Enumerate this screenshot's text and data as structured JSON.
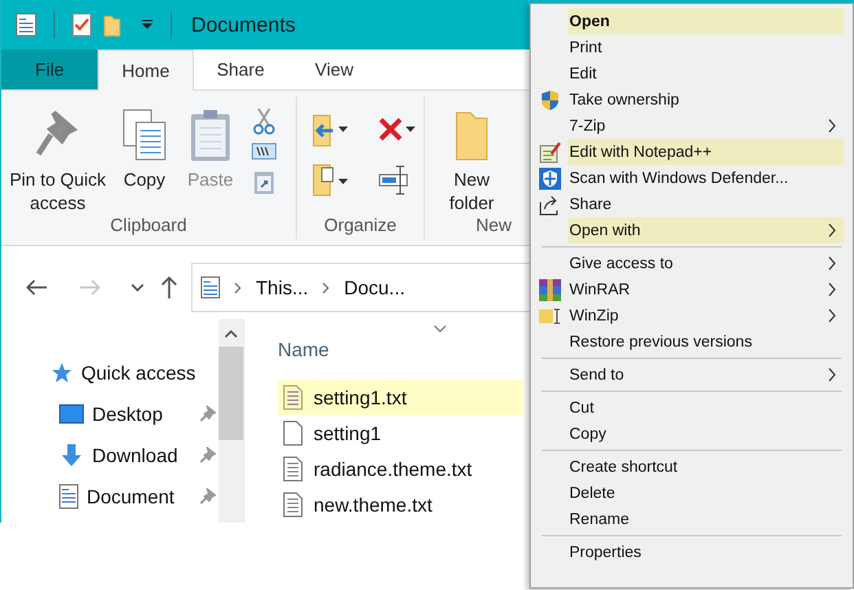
{
  "window": {
    "title": "Documents"
  },
  "ribbon_tabs": [
    {
      "label": "File",
      "kind": "file",
      "selected": false
    },
    {
      "label": "Home",
      "kind": "tab",
      "selected": true
    },
    {
      "label": "Share",
      "kind": "tab",
      "selected": false
    },
    {
      "label": "View",
      "kind": "tab",
      "selected": false
    }
  ],
  "ribbon_groups": [
    {
      "label": "Clipboard",
      "kind": "clipboard",
      "commands": [
        {
          "label": "Pin to Quick access",
          "disabled": false
        },
        {
          "label": "Copy",
          "disabled": false
        },
        {
          "label": "Paste",
          "disabled": true
        }
      ]
    },
    {
      "label": "Organize",
      "kind": "organize"
    },
    {
      "label": "New",
      "kind": "new",
      "commands": [
        {
          "label": "New folder",
          "disabled": false
        }
      ]
    }
  ],
  "nav_buttons": [
    {
      "kind": "back",
      "disabled": false
    },
    {
      "kind": "forward",
      "disabled": true
    },
    {
      "kind": "recent",
      "disabled": false
    },
    {
      "kind": "up",
      "disabled": false
    }
  ],
  "address": {
    "crumbs": [
      "This...",
      "Docu..."
    ]
  },
  "nav_pane": {
    "items": [
      {
        "label": "Quick access",
        "kind": "star",
        "pinned": false
      },
      {
        "label": "Desktop",
        "kind": "desktop",
        "pinned": true
      },
      {
        "label": "Download",
        "kind": "download",
        "pinned": true
      },
      {
        "label": "Document",
        "kind": "document",
        "pinned": true
      }
    ]
  },
  "file_list": {
    "column": "Name",
    "rows": [
      {
        "name": "setting1.txt",
        "kind": "text",
        "selected": true
      },
      {
        "name": "setting1",
        "kind": "blank",
        "selected": false
      },
      {
        "name": "radiance.theme.txt",
        "kind": "text",
        "selected": false
      },
      {
        "name": "new.theme.txt",
        "kind": "text",
        "selected": false
      }
    ]
  },
  "context_menu": {
    "items": [
      {
        "kind": "item",
        "label": "Open",
        "default": true,
        "highlighted": true,
        "submenu": false
      },
      {
        "kind": "item",
        "label": "Print",
        "default": false,
        "highlighted": false,
        "submenu": false
      },
      {
        "kind": "item",
        "label": "Edit",
        "default": false,
        "highlighted": false,
        "submenu": false
      },
      {
        "kind": "item",
        "label": "Take ownership",
        "default": false,
        "highlighted": false,
        "submenu": false
      },
      {
        "kind": "item",
        "label": "7-Zip",
        "default": false,
        "highlighted": false,
        "submenu": true
      },
      {
        "kind": "item",
        "label": "Edit with Notepad++",
        "default": false,
        "highlighted": true,
        "submenu": false
      },
      {
        "kind": "item",
        "label": "Scan with Windows Defender...",
        "default": false,
        "highlighted": false,
        "submenu": false
      },
      {
        "kind": "item",
        "label": "Share",
        "default": false,
        "highlighted": false,
        "submenu": false
      },
      {
        "kind": "item",
        "label": "Open with",
        "default": false,
        "highlighted": true,
        "submenu": true
      },
      {
        "kind": "separator"
      },
      {
        "kind": "item",
        "label": "Give access to",
        "default": false,
        "highlighted": false,
        "submenu": true
      },
      {
        "kind": "item",
        "label": "WinRAR",
        "default": false,
        "highlighted": false,
        "submenu": true
      },
      {
        "kind": "item",
        "label": "WinZip",
        "default": false,
        "highlighted": false,
        "submenu": true
      },
      {
        "kind": "item",
        "label": "Restore previous versions",
        "default": false,
        "highlighted": false,
        "submenu": false
      },
      {
        "kind": "separator"
      },
      {
        "kind": "item",
        "label": "Send to",
        "default": false,
        "highlighted": false,
        "submenu": true
      },
      {
        "kind": "separator"
      },
      {
        "kind": "item",
        "label": "Cut",
        "default": false,
        "highlighted": false,
        "submenu": false
      },
      {
        "kind": "item",
        "label": "Copy",
        "default": false,
        "highlighted": false,
        "submenu": false
      },
      {
        "kind": "separator"
      },
      {
        "kind": "item",
        "label": "Create shortcut",
        "default": false,
        "highlighted": false,
        "submenu": false
      },
      {
        "kind": "item",
        "label": "Delete",
        "default": false,
        "highlighted": false,
        "submenu": false
      },
      {
        "kind": "item",
        "label": "Rename",
        "default": false,
        "highlighted": false,
        "submenu": false
      },
      {
        "kind": "separator"
      },
      {
        "kind": "item",
        "label": "Properties",
        "default": false,
        "highlighted": false,
        "submenu": false
      }
    ]
  }
}
